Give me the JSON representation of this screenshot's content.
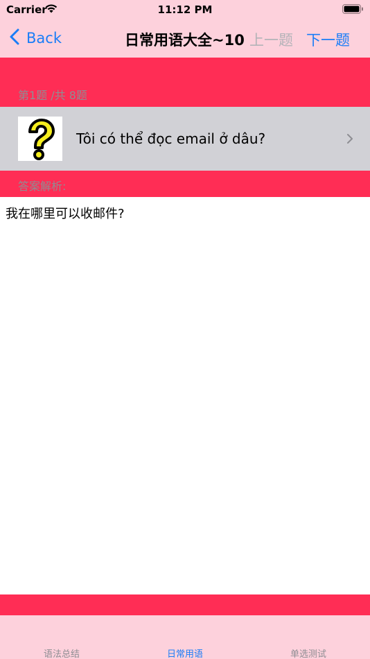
{
  "status_bar": {
    "carrier": "Carrier",
    "time": "11:12 PM"
  },
  "nav": {
    "back_label": "Back",
    "title": "日常用语大全~10",
    "prev_label": "上一题",
    "next_label": "下一题"
  },
  "question_header": "第1题 /共 8题",
  "question": {
    "text": "Tôi có thể đọc email ở dâu?",
    "icon": "question-mark-icon"
  },
  "answer_header": "答案解析:",
  "answer": {
    "text": "我在哪里可以收邮件?"
  },
  "tabs": [
    {
      "label": "语法总结",
      "active": false
    },
    {
      "label": "日常用语",
      "active": true
    },
    {
      "label": "单选测试",
      "active": false
    }
  ],
  "colors": {
    "accent": "#1a7df7",
    "band": "#ff2d55",
    "bar": "#fdd1dc",
    "row": "#d1d1d6"
  }
}
